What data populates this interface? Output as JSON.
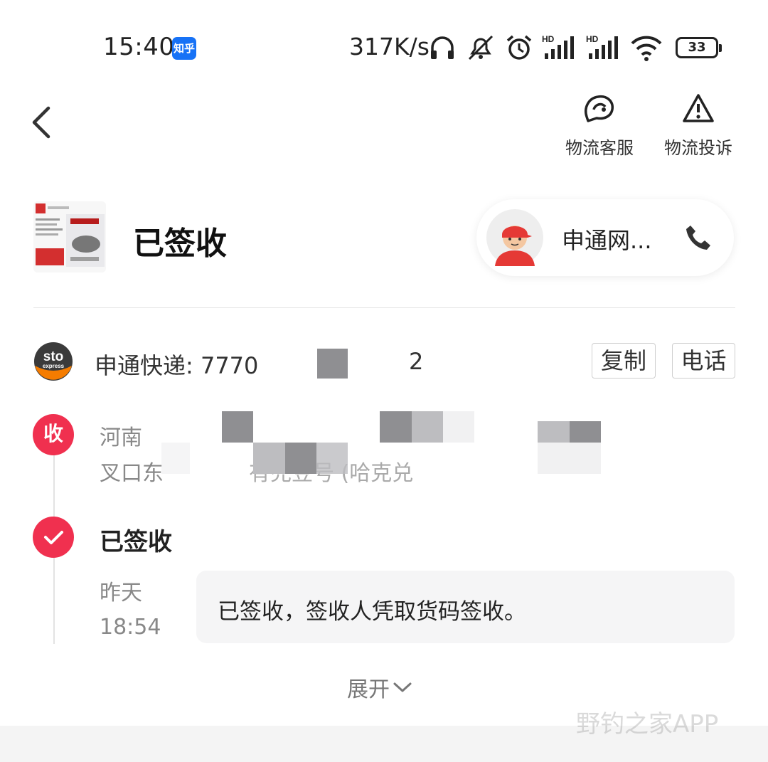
{
  "status_bar": {
    "time": "15:40",
    "app_badge": "知乎",
    "net_speed": "317K/s",
    "battery": "33",
    "icons": [
      "headphones-icon",
      "mute-icon",
      "alarm-icon",
      "signal-hd-icon",
      "signal-hd-icon",
      "wifi-icon",
      "battery-icon"
    ]
  },
  "header": {
    "actions": [
      {
        "label": "物流客服",
        "icon": "customer-service-icon"
      },
      {
        "label": "物流投诉",
        "icon": "warning-icon"
      }
    ]
  },
  "summary": {
    "status": "已签收",
    "courier_name": "申通网..."
  },
  "tracking": {
    "text": "申通快递: 7770",
    "suffix": "2",
    "copy_label": "复制",
    "phone_label": "电话"
  },
  "timeline": {
    "receiver_badge": "收",
    "receiver_line1": "河南",
    "receiver_line2": "叉口东",
    "receiver_line2_tail": "有兜豆号 (哈克兑",
    "event_title": "已签收",
    "event_time_day": "昨天",
    "event_time_clock": "18:54",
    "event_desc": "已签收，签收人凭取货码签收。"
  },
  "expand_label": "展开",
  "watermark": "野钓之家APP",
  "colors": {
    "accent": "#f0304f",
    "zhihu": "#1772f6"
  }
}
